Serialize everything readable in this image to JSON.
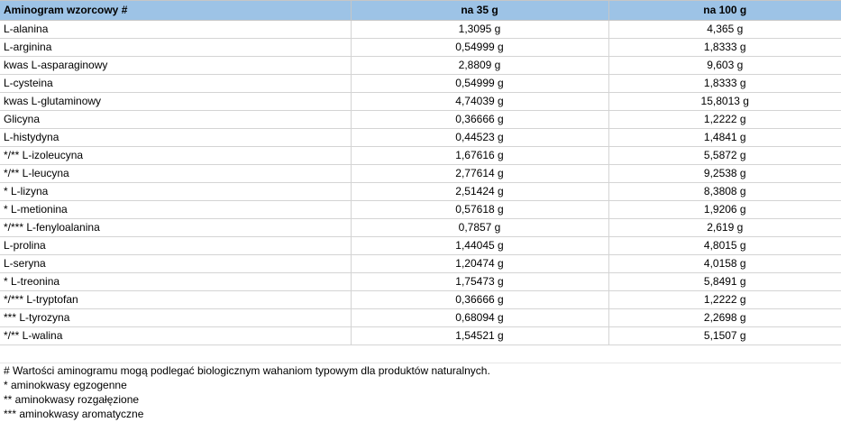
{
  "table": {
    "headers": [
      "Aminogram wzorcowy #",
      "na 35 g",
      "na 100 g"
    ],
    "rows": [
      [
        "L-alanina",
        "1,3095 g",
        "4,365 g"
      ],
      [
        "L-arginina",
        "0,54999 g",
        "1,8333 g"
      ],
      [
        "kwas L-asparaginowy",
        "2,8809 g",
        "9,603 g"
      ],
      [
        "L-cysteina",
        "0,54999 g",
        "1,8333 g"
      ],
      [
        "kwas L-glutaminowy",
        "4,74039 g",
        "15,8013 g"
      ],
      [
        "Glicyna",
        "0,36666 g",
        "1,2222 g"
      ],
      [
        "L-histydyna",
        "0,44523 g",
        "1,4841 g"
      ],
      [
        "*/** L-izoleucyna",
        "1,67616 g",
        "5,5872 g"
      ],
      [
        "*/** L-leucyna",
        "2,77614 g",
        "9,2538 g"
      ],
      [
        "* L-lizyna",
        "2,51424 g",
        "8,3808 g"
      ],
      [
        "* L-metionina",
        "0,57618 g",
        "1,9206 g"
      ],
      [
        "*/*** L-fenyloalanina",
        "0,7857 g",
        "2,619 g"
      ],
      [
        "L-prolina",
        "1,44045 g",
        "4,8015 g"
      ],
      [
        "L-seryna",
        "1,20474 g",
        "4,0158 g"
      ],
      [
        "* L-treonina",
        "1,75473 g",
        "5,8491 g"
      ],
      [
        "*/*** L-tryptofan",
        "0,36666 g",
        "1,2222 g"
      ],
      [
        "*** L-tyrozyna",
        "0,68094 g",
        "2,2698 g"
      ],
      [
        "*/** L-walina",
        "1,54521 g",
        "5,1507 g"
      ]
    ]
  },
  "notes": [
    "# Wartości aminogramu mogą podlegać biologicznym wahaniom typowym dla produktów naturalnych.",
    "* aminokwasy egzogenne",
    "** aminokwasy rozgałęzione",
    "*** aminokwasy aromatyczne"
  ],
  "colors": {
    "header_bg": "#9dc3e6",
    "grid": "#d4d4d4"
  }
}
